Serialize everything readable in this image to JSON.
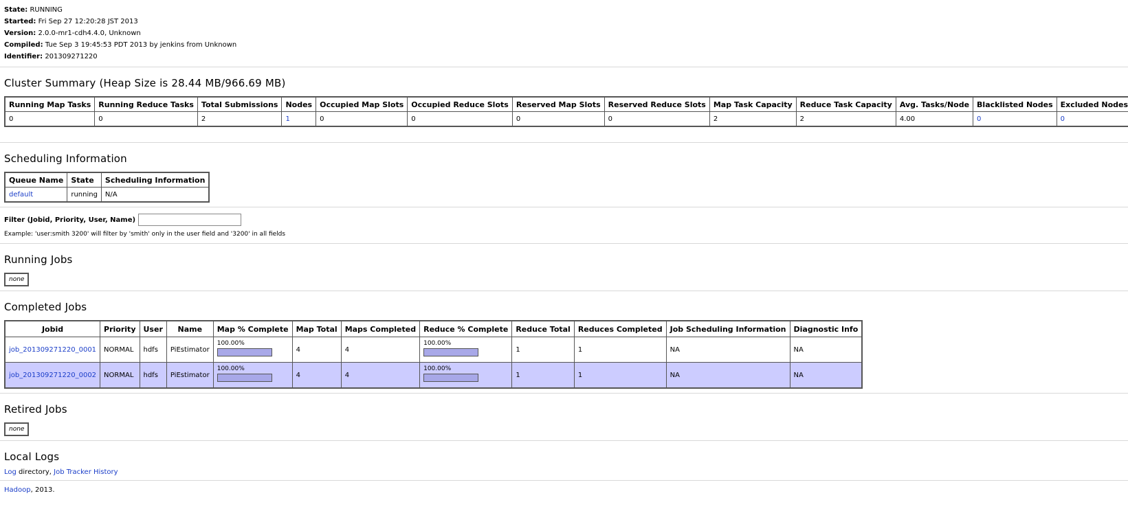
{
  "info": {
    "state_label": "State:",
    "state": "RUNNING",
    "started_label": "Started:",
    "started": "Fri Sep 27 12:20:28 JST 2013",
    "version_label": "Version:",
    "version": "2.0.0-mr1-cdh4.4.0, Unknown",
    "compiled_label": "Compiled:",
    "compiled": "Tue Sep 3 19:45:53 PDT 2013 by jenkins from Unknown",
    "identifier_label": "Identifier:",
    "identifier": "201309271220"
  },
  "cluster_summary": {
    "title": "Cluster Summary (Heap Size is 28.44 MB/966.69 MB)",
    "headers": [
      "Running Map Tasks",
      "Running Reduce Tasks",
      "Total Submissions",
      "Nodes",
      "Occupied Map Slots",
      "Occupied Reduce Slots",
      "Reserved Map Slots",
      "Reserved Reduce Slots",
      "Map Task Capacity",
      "Reduce Task Capacity",
      "Avg. Tasks/Node",
      "Blacklisted Nodes",
      "Excluded Nodes"
    ],
    "values": [
      "0",
      "0",
      "2",
      "1",
      "0",
      "0",
      "0",
      "0",
      "2",
      "2",
      "4.00",
      "0",
      "0"
    ],
    "link_columns": [
      3,
      11,
      12
    ]
  },
  "scheduling": {
    "title": "Scheduling Information",
    "headers": [
      "Queue Name",
      "State",
      "Scheduling Information"
    ],
    "rows": [
      [
        "default",
        "running",
        "N/A"
      ]
    ]
  },
  "filter": {
    "label": "Filter (Jobid, Priority, User, Name)",
    "value": "",
    "example": "Example: 'user:smith 3200' will filter by 'smith' only in the user field and '3200' in all fields"
  },
  "running_jobs": {
    "title": "Running Jobs",
    "none": "none"
  },
  "completed_jobs": {
    "title": "Completed Jobs",
    "headers": [
      "Jobid",
      "Priority",
      "User",
      "Name",
      "Map % Complete",
      "Map Total",
      "Maps Completed",
      "Reduce % Complete",
      "Reduce Total",
      "Reduces Completed",
      "Job Scheduling Information",
      "Diagnostic Info"
    ],
    "rows": [
      {
        "jobid": "job_201309271220_0001",
        "priority": "NORMAL",
        "user": "hdfs",
        "name": "PiEstimator",
        "map_pct": "100.00%",
        "map_fraction": 1.0,
        "map_total": "4",
        "maps_completed": "4",
        "reduce_pct": "100.00%",
        "reduce_fraction": 1.0,
        "reduce_total": "1",
        "reduces_completed": "1",
        "sched_info": "NA",
        "diag_info": "NA"
      },
      {
        "jobid": "job_201309271220_0002",
        "priority": "NORMAL",
        "user": "hdfs",
        "name": "PiEstimator",
        "map_pct": "100.00%",
        "map_fraction": 1.0,
        "map_total": "4",
        "maps_completed": "4",
        "reduce_pct": "100.00%",
        "reduce_fraction": 1.0,
        "reduce_total": "1",
        "reduces_completed": "1",
        "sched_info": "NA",
        "diag_info": "NA"
      }
    ]
  },
  "retired_jobs": {
    "title": "Retired Jobs",
    "none": "none"
  },
  "local_logs": {
    "title": "Local Logs",
    "log_link": "Log",
    "directory_text": " directory, ",
    "history_link": "Job Tracker History"
  },
  "footer": {
    "hadoop_link": "Hadoop",
    "year_text": ", 2013."
  },
  "colors": {
    "link": "#1a3dc8",
    "alt_row": "#ccccff",
    "progress_fill": "#a8a8e8"
  }
}
